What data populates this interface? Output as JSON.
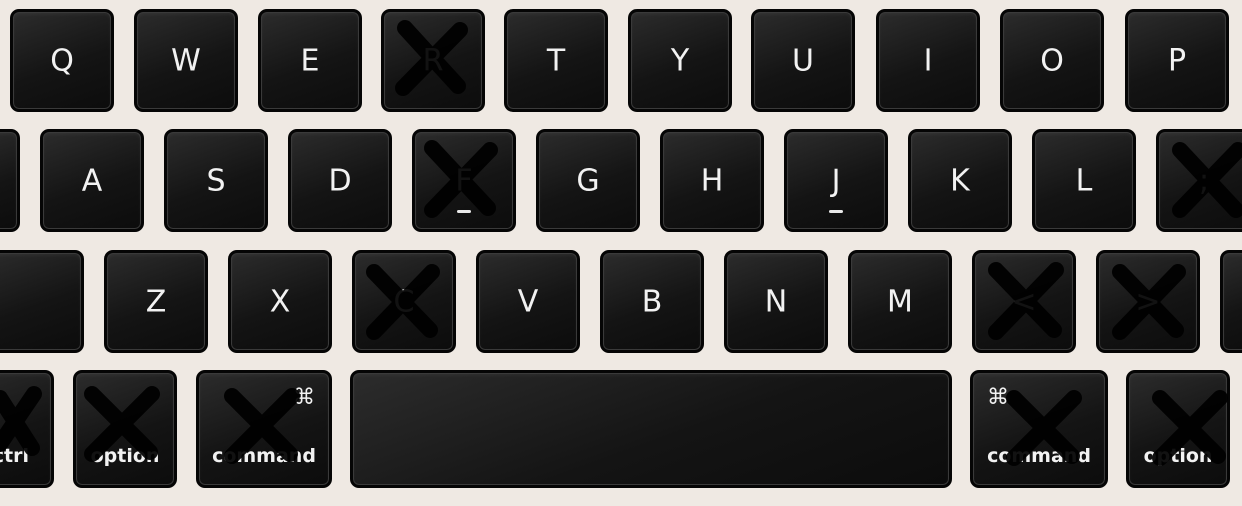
{
  "rows": {
    "top": [
      "Q",
      "W",
      "E",
      "R",
      "T",
      "Y",
      "U",
      "I",
      "O",
      "P"
    ],
    "home": [
      "A",
      "S",
      "D",
      "F",
      "G",
      "H",
      "J",
      "K",
      "L",
      ";"
    ],
    "bottom": [
      "Z",
      "X",
      "C",
      "V",
      "B",
      "N",
      "M",
      "<",
      ">"
    ],
    "modifiers": {
      "control": "ctrl",
      "option_left": "option",
      "command_left": "command",
      "command_symbol": "⌘",
      "command_right": "command",
      "option_right": "option"
    }
  },
  "crossed_out": [
    "R",
    "F",
    ";",
    "C",
    "<",
    ">",
    "control",
    "option",
    "command"
  ],
  "colors": {
    "background": "#efe9e3",
    "key": "#141414",
    "legend": "#f2f2f2",
    "cross": "#000000"
  }
}
